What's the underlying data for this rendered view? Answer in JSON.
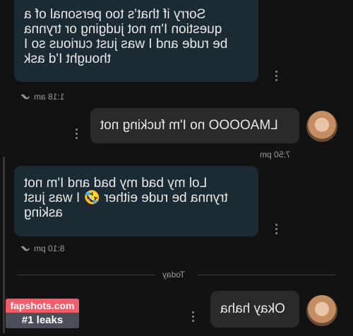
{
  "messages": [
    {
      "text": "Sorry if that’s too personal of a\nquestion I'm not judging or trynna\nbe rude and I was just curious so I\nthought I'd ask",
      "time": "1:18 am"
    },
    {
      "text": "LMAOOOO no I'm fucking not",
      "time": "7:50 pm"
    },
    {
      "text": "Lol my bad my bad and I'm not\ntrynna be rude either 🤣 I was just\nasking",
      "time": "8:10 pm"
    },
    {
      "text": "Okay haha"
    }
  ],
  "divider": {
    "label": "Today"
  },
  "watermark": {
    "site": "fapshots.com",
    "tag": "#1 leaks"
  },
  "icons": {
    "menu": "more-vertical-icon",
    "read": "double-check-icon",
    "avatar": "profile-photo"
  }
}
